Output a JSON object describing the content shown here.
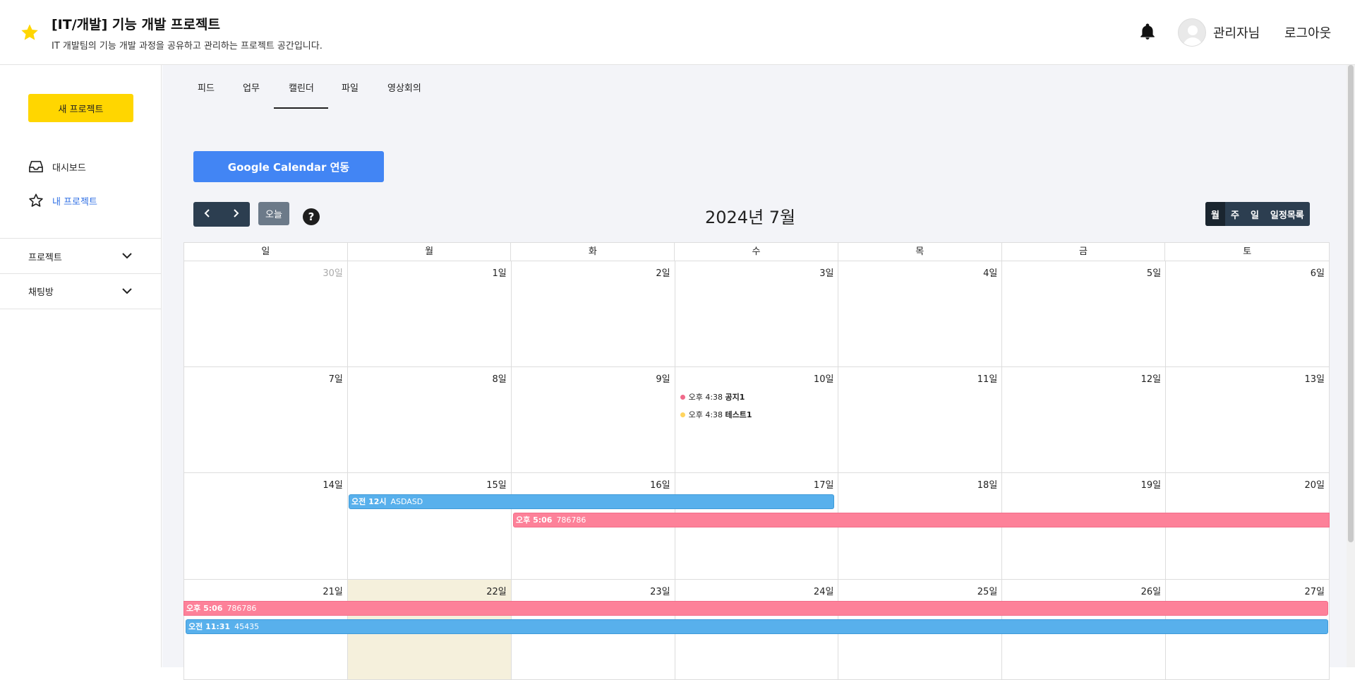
{
  "header": {
    "title": "[IT/개발] 기능 개발 프로젝트",
    "subtitle": "IT 개발팀의 기능 개발 과정을 공유하고 관리하는 프로젝트 공간입니다.",
    "user": "관리자님",
    "logout": "로그아웃"
  },
  "sidebar": {
    "new_project": "새 프로젝트",
    "items": [
      {
        "label": "대시보드"
      },
      {
        "label": "내 프로젝트"
      }
    ],
    "sections": [
      {
        "label": "프로젝트"
      },
      {
        "label": "채팅방"
      }
    ]
  },
  "tabs": [
    {
      "label": "피드"
    },
    {
      "label": "업무"
    },
    {
      "label": "캘린더"
    },
    {
      "label": "파일"
    },
    {
      "label": "영상회의"
    }
  ],
  "calendar": {
    "google_button": "Google Calendar 연동",
    "today": "오늘",
    "help": "?",
    "title": "2024년 7월",
    "views": [
      "월",
      "주",
      "일",
      "일정목록"
    ],
    "active_view": "월",
    "weekdays": [
      "일",
      "월",
      "화",
      "수",
      "목",
      "금",
      "토"
    ],
    "weeks": [
      [
        "30일",
        "1일",
        "2일",
        "3일",
        "4일",
        "5일",
        "6일"
      ],
      [
        "7일",
        "8일",
        "9일",
        "10일",
        "11일",
        "12일",
        "13일"
      ],
      [
        "14일",
        "15일",
        "16일",
        "17일",
        "18일",
        "19일",
        "20일"
      ],
      [
        "21일",
        "22일",
        "23일",
        "24일",
        "25일",
        "26일",
        "27일"
      ]
    ],
    "today_date": "22일",
    "events": {
      "e1_time": "오후 4:38",
      "e1_title": "공지1",
      "e1_color": "#f06a8a",
      "e2_time": "오후 4:38",
      "e2_title": "테스트1",
      "e2_color": "#ffd45e",
      "b1_time": "오전 12시",
      "b1_title": "ASDASD",
      "b2_time": "오후 5:06",
      "b2_title": "786786",
      "b3_time": "오후 5:06",
      "b3_title": "786786",
      "b4_time": "오전 11:31",
      "b4_title": "45435"
    }
  },
  "colors": {
    "accent_yellow": "#ffd600",
    "google_blue": "#4285f4",
    "event_blue": "#58b0ec",
    "event_pink": "#fd8199"
  }
}
